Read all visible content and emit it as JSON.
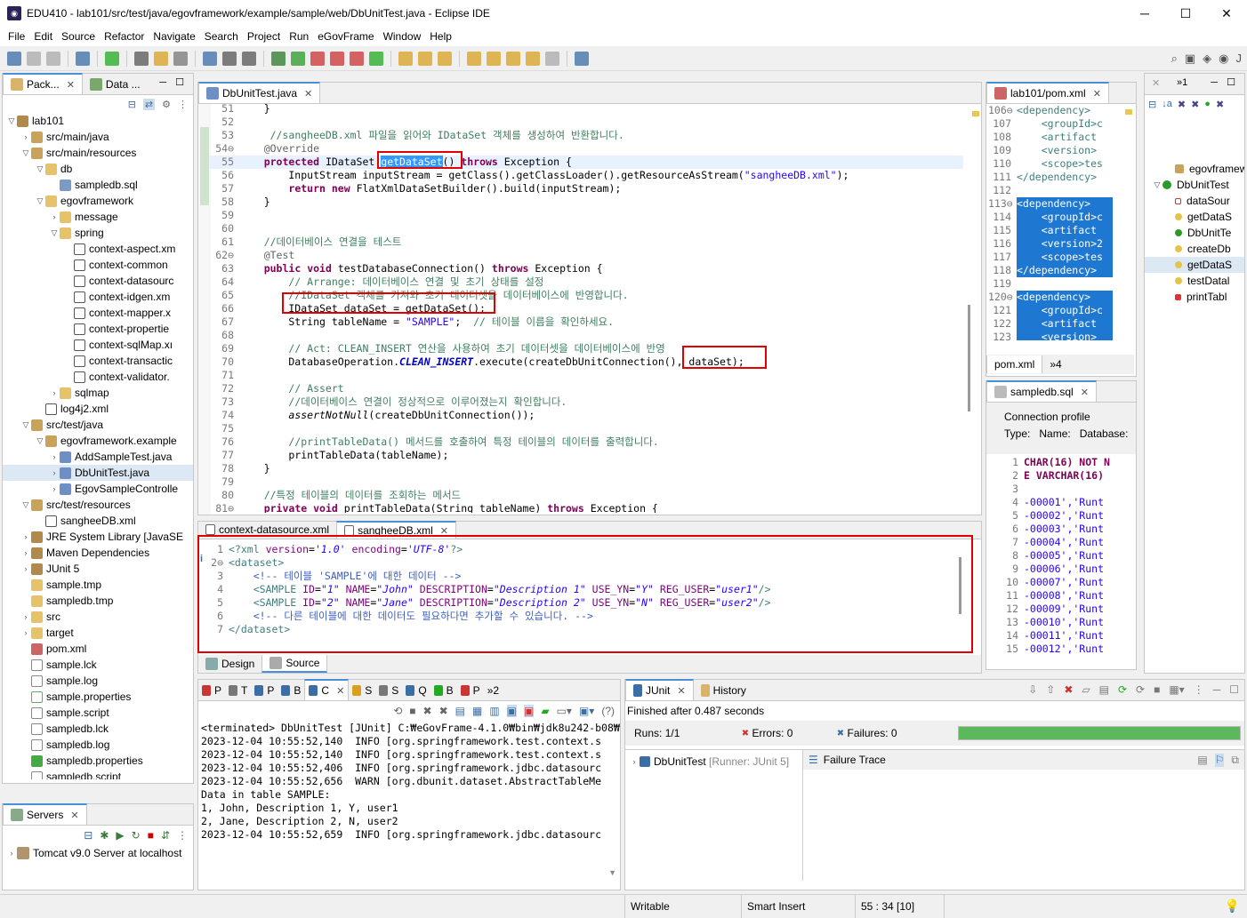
{
  "window": {
    "title": "EDU410 - lab101/src/test/java/egovframework/example/sample/web/DbUnitTest.java - Eclipse IDE"
  },
  "menu": [
    "File",
    "Edit",
    "Source",
    "Refactor",
    "Navigate",
    "Search",
    "Project",
    "Run",
    "eGovFrame",
    "Window",
    "Help"
  ],
  "left_panel": {
    "tabs": [
      "Pack...",
      "Data ..."
    ],
    "tree": [
      {
        "depth": 0,
        "tw": "▽",
        "icon": "project",
        "label": "lab101"
      },
      {
        "depth": 1,
        "tw": "›",
        "icon": "pkgfolder",
        "label": "src/main/java"
      },
      {
        "depth": 1,
        "tw": "▽",
        "icon": "pkgfolder",
        "label": "src/main/resources"
      },
      {
        "depth": 2,
        "tw": "▽",
        "icon": "folder",
        "label": "db"
      },
      {
        "depth": 3,
        "tw": "",
        "icon": "sqlfile",
        "label": "sampledb.sql"
      },
      {
        "depth": 2,
        "tw": "▽",
        "icon": "folder",
        "label": "egovframework"
      },
      {
        "depth": 3,
        "tw": "›",
        "icon": "folder",
        "label": "message"
      },
      {
        "depth": 3,
        "tw": "▽",
        "icon": "folder",
        "label": "spring"
      },
      {
        "depth": 4,
        "tw": "",
        "icon": "xml",
        "label": "context-aspect.xm"
      },
      {
        "depth": 4,
        "tw": "",
        "icon": "xml",
        "label": "context-common"
      },
      {
        "depth": 4,
        "tw": "",
        "icon": "xml",
        "label": "context-datasourc"
      },
      {
        "depth": 4,
        "tw": "",
        "icon": "xml",
        "label": "context-idgen.xm"
      },
      {
        "depth": 4,
        "tw": "",
        "icon": "xml",
        "label": "context-mapper.x"
      },
      {
        "depth": 4,
        "tw": "",
        "icon": "xml",
        "label": "context-propertie"
      },
      {
        "depth": 4,
        "tw": "",
        "icon": "xml",
        "label": "context-sqlMap.xı"
      },
      {
        "depth": 4,
        "tw": "",
        "icon": "xml",
        "label": "context-transactic"
      },
      {
        "depth": 4,
        "tw": "",
        "icon": "xml",
        "label": "context-validator."
      },
      {
        "depth": 3,
        "tw": "›",
        "icon": "folder",
        "label": "sqlmap"
      },
      {
        "depth": 2,
        "tw": "",
        "icon": "xml",
        "label": "log4j2.xml"
      },
      {
        "depth": 1,
        "tw": "▽",
        "icon": "pkgfolder",
        "label": "src/test/java"
      },
      {
        "depth": 2,
        "tw": "▽",
        "icon": "package",
        "label": "egovframework.example"
      },
      {
        "depth": 3,
        "tw": "›",
        "icon": "java",
        "label": "AddSampleTest.java"
      },
      {
        "depth": 3,
        "tw": "›",
        "icon": "java",
        "label": "DbUnitTest.java",
        "selected": true
      },
      {
        "depth": 3,
        "tw": "›",
        "icon": "java",
        "label": "EgovSampleControlle"
      },
      {
        "depth": 1,
        "tw": "▽",
        "icon": "pkgfolder",
        "label": "src/test/resources"
      },
      {
        "depth": 2,
        "tw": "",
        "icon": "xml",
        "label": "sangheeDB.xml"
      },
      {
        "depth": 1,
        "tw": "›",
        "icon": "lib",
        "label": "JRE System Library [JavaSE"
      },
      {
        "depth": 1,
        "tw": "›",
        "icon": "lib",
        "label": "Maven Dependencies"
      },
      {
        "depth": 1,
        "tw": "›",
        "icon": "lib",
        "label": "JUnit 5"
      },
      {
        "depth": 1,
        "tw": "",
        "icon": "folder",
        "label": "sample.tmp"
      },
      {
        "depth": 1,
        "tw": "",
        "icon": "folder",
        "label": "sampledb.tmp"
      },
      {
        "depth": 1,
        "tw": "›",
        "icon": "folder",
        "label": "src"
      },
      {
        "depth": 1,
        "tw": "›",
        "icon": "folder",
        "label": "target"
      },
      {
        "depth": 1,
        "tw": "",
        "icon": "pom",
        "label": "pom.xml"
      },
      {
        "depth": 1,
        "tw": "",
        "icon": "file",
        "label": "sample.lck"
      },
      {
        "depth": 1,
        "tw": "",
        "icon": "file",
        "label": "sample.log"
      },
      {
        "depth": 1,
        "tw": "",
        "icon": "props",
        "label": "sample.properties"
      },
      {
        "depth": 1,
        "tw": "",
        "icon": "file",
        "label": "sample.script"
      },
      {
        "depth": 1,
        "tw": "",
        "icon": "file",
        "label": "sampledb.lck"
      },
      {
        "depth": 1,
        "tw": "",
        "icon": "file",
        "label": "sampledb.log"
      },
      {
        "depth": 1,
        "tw": "",
        "icon": "propsgreen",
        "label": "sampledb.properties"
      },
      {
        "depth": 1,
        "tw": "",
        "icon": "file",
        "label": "sampledb.script"
      }
    ]
  },
  "servers": {
    "tab": "Servers",
    "item": "Tomcat v9.0 Server at localhost"
  },
  "editor": {
    "tab": "DbUnitTest.java",
    "lines": [
      {
        "n": "51",
        "html": "    }"
      },
      {
        "n": "52",
        "html": ""
      },
      {
        "n": "53",
        "html": "     <span class='cm'>//sangheeDB.xml 파일을 읽어와 IDataSet 객체를 생성하여 반환합니다.</span>"
      },
      {
        "n": "54⊖",
        "html": "    <span class='an'>@Override</span>"
      },
      {
        "n": "55",
        "html": "    <span class='kw'>protected</span> IDataSet <span style='background:#3399ff;color:#fff'>getDataSet</span>() <span class='kw'>throws</span> Exception {",
        "current": true
      },
      {
        "n": "56",
        "html": "        InputStream inputStream = getClass().getClassLoader().getResourceAsStream(<span class='st'>\"sangheeDB.xml\"</span>);"
      },
      {
        "n": "57",
        "html": "        <span class='kw'>return</span> <span class='kw'>new</span> FlatXmlDataSetBuilder().build(inputStream);"
      },
      {
        "n": "58",
        "html": "    }"
      },
      {
        "n": "59",
        "html": ""
      },
      {
        "n": "60",
        "html": ""
      },
      {
        "n": "61",
        "html": "    <span class='cm'>//데이터베이스 연결을 테스트</span>"
      },
      {
        "n": "62⊖",
        "html": "    <span class='an'>@Test</span>"
      },
      {
        "n": "63",
        "html": "    <span class='kw'>public</span> <span class='kw'>void</span> testDatabaseConnection() <span class='kw'>throws</span> Exception {"
      },
      {
        "n": "64",
        "html": "        <span class='cm'>// Arrange: 데이터베이스 연결 및 초기 상태를 설정</span>"
      },
      {
        "n": "65",
        "html": "        <span class='cm'>//IDataSet 객체를 가져와 초기 데이터셋을 데이터베이스에 반영합니다.</span>"
      },
      {
        "n": "66",
        "html": "        IDataSet dataSet = getDataSet();"
      },
      {
        "n": "67",
        "html": "        String tableName = <span class='st'>\"SAMPLE\"</span>;  <span class='cm'>// 테이블 이름을 확인하세요.</span>"
      },
      {
        "n": "68",
        "html": ""
      },
      {
        "n": "69",
        "html": "        <span class='cm'>// Act: CLEAN_INSERT 연산을 사용하여 초기 데이터셋을 데이터베이스에 반영</span>"
      },
      {
        "n": "70",
        "html": "        DatabaseOperation.<span class='fld itl' style='font-weight:bold'>CLEAN_INSERT</span>.execute(createDbUnitConnection(), dataSet);"
      },
      {
        "n": "71",
        "html": ""
      },
      {
        "n": "72",
        "html": "        <span class='cm'>// Assert</span>"
      },
      {
        "n": "73",
        "html": "        <span class='cm'>//데이터베이스 연결이 정상적으로 이루어졌는지 확인합니다.</span>"
      },
      {
        "n": "74",
        "html": "        <span class='itl'>assertNotNull</span>(createDbUnitConnection());"
      },
      {
        "n": "75",
        "html": ""
      },
      {
        "n": "76",
        "html": "        <span class='cm'>//printTableData() 메서드를 호출하여 특정 테이블의 데이터를 출력합니다.</span>"
      },
      {
        "n": "77",
        "html": "        printTableData(tableName);"
      },
      {
        "n": "78",
        "html": "    }"
      },
      {
        "n": "79",
        "html": ""
      },
      {
        "n": "80",
        "html": "    <span class='cm'>//특정 테이블의 데이터를 조회하는 메서드</span>"
      },
      {
        "n": "81⊖",
        "html": "    <span class='kw'>private</span> <span class='kw'>void</span> printTableData(String tableName) <span class='kw'>throws</span> Exception {"
      }
    ]
  },
  "xml_editor": {
    "tabs": [
      "context-datasource.xml",
      "sangheeDB.xml"
    ],
    "lines": [
      {
        "n": "1",
        "html": "<span class='xmltag'>&lt;?xml</span> <span class='xmlattr'>version</span>=<span class='xmlval'>'1.0'</span> <span class='xmlattr'>encoding</span>=<span class='xmlval'>'UTF-8'</span><span class='xmltag'>?&gt;</span>"
      },
      {
        "n": "2⊖",
        "html": "<span class='xmltag'>&lt;dataset&gt;</span>"
      },
      {
        "n": "3",
        "html": "    <span style='color:#3f5fbf'>&lt;!-- 테이블 'SAMPLE'에 대한 데이터 --&gt;</span>"
      },
      {
        "n": "4",
        "html": "    <span class='xmltag'>&lt;SAMPLE</span> <span class='xmlattr'>ID</span>=<span class='xmlval'>\"1\"</span> <span class='xmlattr'>NAME</span>=<span class='xmlval'>\"John\"</span> <span class='xmlattr'>DESCRIPTION</span>=<span class='xmlval'>\"Description 1\"</span> <span class='xmlattr'>USE_YN</span>=<span class='xmlval'>\"Y\"</span> <span class='xmlattr'>REG_USER</span>=<span class='xmlval'>\"user1\"</span><span class='xmltag'>/&gt;</span>"
      },
      {
        "n": "5",
        "html": "    <span class='xmltag'>&lt;SAMPLE</span> <span class='xmlattr'>ID</span>=<span class='xmlval'>\"2\"</span> <span class='xmlattr'>NAME</span>=<span class='xmlval'>\"Jane\"</span> <span class='xmlattr'>DESCRIPTION</span>=<span class='xmlval'>\"Description 2\"</span> <span class='xmlattr'>USE_YN</span>=<span class='xmlval'>\"N\"</span> <span class='xmlattr'>REG_USER</span>=<span class='xmlval'>\"user2\"</span><span class='xmltag'>/&gt;</span>"
      },
      {
        "n": "6",
        "html": "    <span style='color:#3f5fbf'>&lt;!-- 다른 테이블에 대한 데이터도 필요하다면 추가할 수 있습니다. --&gt;</span>"
      },
      {
        "n": "7",
        "html": "<span class='xmltag'>&lt;/dataset&gt;</span>"
      }
    ],
    "bottom_tabs": [
      "Design",
      "Source"
    ]
  },
  "pom_editor": {
    "tab": "lab101/pom.xml",
    "lines": [
      {
        "n": "106⊖",
        "t": "<dependency>",
        "sel": false
      },
      {
        "n": "107",
        "t": "    <groupId>c",
        "sel": false
      },
      {
        "n": "108",
        "t": "    <artifact",
        "sel": false
      },
      {
        "n": "109",
        "t": "    <version>",
        "sel": false
      },
      {
        "n": "110",
        "t": "    <scope>tes",
        "sel": false
      },
      {
        "n": "111",
        "t": "</dependency>",
        "sel": false
      },
      {
        "n": "112",
        "t": "",
        "sel": false
      },
      {
        "n": "113⊖",
        "t": "<dependency>",
        "sel": true
      },
      {
        "n": "114",
        "t": "    <groupId>c",
        "sel": true
      },
      {
        "n": "115",
        "t": "    <artifact",
        "sel": true
      },
      {
        "n": "116",
        "t": "    <version>2",
        "sel": true
      },
      {
        "n": "117",
        "t": "    <scope>tes",
        "sel": true
      },
      {
        "n": "118",
        "t": "</dependency>",
        "sel": true
      },
      {
        "n": "119",
        "t": "",
        "sel": false
      },
      {
        "n": "120⊖",
        "t": "<dependency>",
        "sel": true
      },
      {
        "n": "121",
        "t": "    <groupId>c",
        "sel": true
      },
      {
        "n": "122",
        "t": "    <artifact",
        "sel": true
      },
      {
        "n": "123",
        "t": "    <version>",
        "sel": true
      }
    ],
    "bottom_tabs": [
      "pom.xml",
      "»4"
    ]
  },
  "sql_editor": {
    "tab": "sampledb.sql",
    "connection_profile": "Connection profile",
    "fields": [
      "Type:",
      "Name:",
      "Database:"
    ],
    "lines": [
      {
        "n": "1",
        "t": "CHAR(16) NOT N"
      },
      {
        "n": "2",
        "t": "E VARCHAR(16)"
      },
      {
        "n": "3",
        "t": ""
      },
      {
        "n": "4",
        "t": "-00001','Runt"
      },
      {
        "n": "5",
        "t": "-00002','Runt"
      },
      {
        "n": "6",
        "t": "-00003','Runt"
      },
      {
        "n": "7",
        "t": "-00004','Runt"
      },
      {
        "n": "8",
        "t": "-00005','Runt"
      },
      {
        "n": "9",
        "t": "-00006','Runt"
      },
      {
        "n": "10",
        "t": "-00007','Runt"
      },
      {
        "n": "11",
        "t": "-00008','Runt"
      },
      {
        "n": "12",
        "t": "-00009','Runt"
      },
      {
        "n": "13",
        "t": "-00010','Runt"
      },
      {
        "n": "14",
        "t": "-00011','Runt"
      },
      {
        "n": "15",
        "t": "-00012','Runt"
      }
    ]
  },
  "outline": {
    "items": [
      {
        "depth": 1,
        "icon": "pkg",
        "label": "egovframew"
      },
      {
        "depth": 0,
        "icon": "class",
        "label": "DbUnitTest",
        "tw": "▽"
      },
      {
        "depth": 1,
        "icon": "field",
        "label": "dataSour"
      },
      {
        "depth": 1,
        "icon": "method",
        "label": "getDataS"
      },
      {
        "depth": 1,
        "icon": "ctor",
        "label": "DbUnitTe"
      },
      {
        "depth": 1,
        "icon": "method",
        "label": "createDb"
      },
      {
        "depth": 1,
        "icon": "method",
        "label": "getDataS",
        "selected": true
      },
      {
        "depth": 1,
        "icon": "method",
        "label": "testDatal"
      },
      {
        "depth": 1,
        "icon": "pmethod",
        "label": "printTabl"
      }
    ]
  },
  "console": {
    "tabs": [
      "P",
      "T",
      "P",
      "B",
      "C",
      "S",
      "S",
      "Q",
      "B",
      "P",
      "»2"
    ],
    "header": "<terminated> DbUnitTest [JUnit] C:₩eGovFrame-4.1.0₩bin₩jdk8u242-b08₩bin₩javaw.e",
    "lines": [
      "2023-12-04 10:55:52,140  INFO [org.springframework.test.context.s",
      "2023-12-04 10:55:52,140  INFO [org.springframework.test.context.s",
      "2023-12-04 10:55:52,406  INFO [org.springframework.jdbc.datasourc",
      "2023-12-04 10:55:52,656  WARN [org.dbunit.dataset.AbstractTableMe",
      "Data in table SAMPLE:",
      "1, John, Description 1, Y, user1",
      "2, Jane, Description 2, N, user2",
      "2023-12-04 10:55:52,659  INFO [org.springframework.jdbc.datasourc"
    ]
  },
  "junit": {
    "tabs": [
      "JUnit",
      "History"
    ],
    "finished": "Finished after 0.487 seconds",
    "runs_label": "Runs:",
    "runs": "1/1",
    "errors_label": "Errors:",
    "errors": "0",
    "failures_label": "Failures:",
    "failures": "0",
    "progress": 1.0,
    "test": "DbUnitTest",
    "runner": "[Runner: JUnit 5]",
    "failure_trace": "Failure Trace"
  },
  "status": {
    "writable": "Writable",
    "insert": "Smart Insert",
    "position": "55 : 34 [10]"
  },
  "colors": {
    "success": "#5cb85c",
    "selection": "#3399ff",
    "highlight_box": "#e00000"
  }
}
